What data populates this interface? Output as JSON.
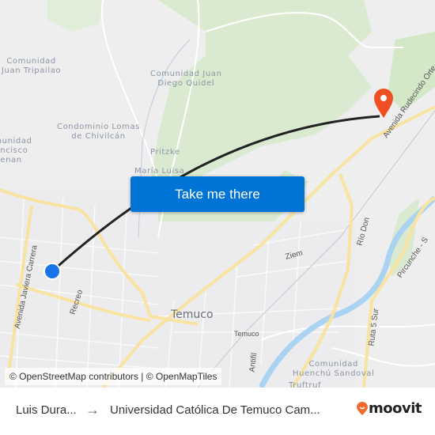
{
  "map": {
    "place_labels": [
      {
        "id": "comunidad-juan-tripailao",
        "lines": [
          "Comunidad",
          "Juan Tripailao"
        ]
      },
      {
        "id": "comunidad-juan-diego-quidel",
        "lines": [
          "Comunidad Juan",
          "Diego Quidel"
        ]
      },
      {
        "id": "condominio-lomas-de-chivilcan",
        "lines": [
          "Condominio Lomas",
          "de Chivilcán"
        ]
      },
      {
        "id": "comunidad-francisco-lienan",
        "lines": [
          "Comunidad",
          "Francisco",
          "Lienan"
        ]
      },
      {
        "id": "pritzke",
        "lines": [
          "Pritzke"
        ]
      },
      {
        "id": "maria-luisa",
        "lines": [
          "María Luisa"
        ]
      },
      {
        "id": "comunidad-huenchu-sandoval",
        "lines": [
          "Comunidad",
          "Huenchú Sandoval"
        ]
      },
      {
        "id": "truftruf",
        "lines": [
          "Truftruf"
        ]
      }
    ],
    "road_labels": {
      "avenida_javiera_carrera": "Avenida Javiera Carrera",
      "recreo": "Recreo",
      "ziem": "Ziem",
      "rio_don": "Río Don",
      "pircunche": "Pircunche - S",
      "ruta_5_sur": "Ruta 5 Sur",
      "antifil": "Antifil",
      "avenida_rudecindo_ortega": "Avenida Rudecindo Orte"
    },
    "city_label": "Temuco",
    "station_label": "Temuco",
    "origin_marker_color": "#1a73e8",
    "destination_marker_color": "#f04e23",
    "route_line_color": "#222222"
  },
  "cta": {
    "label": "Take me there",
    "color": "#0073d6"
  },
  "attribution": "© OpenStreetMap contributors | © OpenMapTiles",
  "footer": {
    "origin": "Luis Dura...",
    "arrow": "→",
    "destination": "Universidad Católica De Temuco Cam...",
    "brand": "moovit",
    "brand_color": "#f26a2e"
  }
}
